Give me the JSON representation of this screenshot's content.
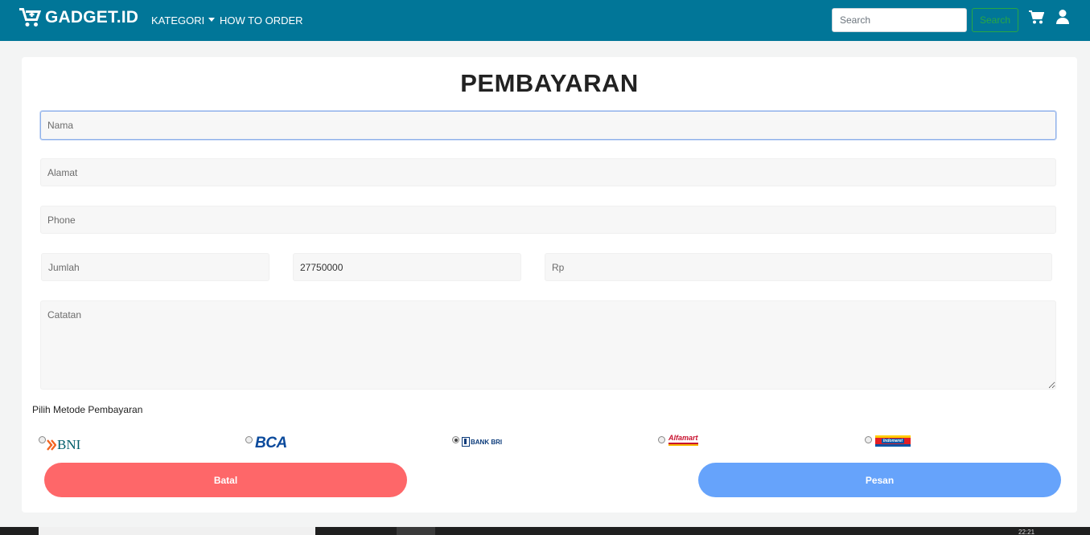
{
  "navbar": {
    "brand": "GADGET.ID",
    "links": [
      {
        "label": "KATEGORI",
        "dropdown": true
      },
      {
        "label": "HOW TO ORDER",
        "dropdown": false
      }
    ],
    "search": {
      "placeholder": "Search",
      "value": "",
      "button_label": "Search"
    },
    "icons": [
      "cart-icon",
      "user-icon"
    ],
    "colors": {
      "background": "#017698",
      "search_button": "#28a745"
    }
  },
  "form": {
    "title": "PEMBAYARAN",
    "fields": {
      "nama": {
        "placeholder": "Nama",
        "value": ""
      },
      "alamat": {
        "placeholder": "Alamat",
        "value": ""
      },
      "phone": {
        "placeholder": "Phone",
        "value": ""
      },
      "jumlah": {
        "placeholder": "Jumlah",
        "value": ""
      },
      "harga": {
        "placeholder": "",
        "value": "27750000"
      },
      "rp": {
        "placeholder": "Rp",
        "value": ""
      },
      "catatan": {
        "placeholder": "Catatan",
        "value": ""
      }
    },
    "payment_label": "Pilih Metode Pembayaran",
    "payment_methods": [
      {
        "name": "BNI",
        "logo_text": "BNI",
        "selected": false
      },
      {
        "name": "BCA",
        "logo_text": "BCA",
        "selected": false
      },
      {
        "name": "BANK BRI",
        "logo_text": "BANK BRI",
        "selected": true
      },
      {
        "name": "Alfamart",
        "logo_text": "Alfamart",
        "selected": false
      },
      {
        "name": "Indomaret",
        "logo_text": "Indomaret",
        "selected": false
      }
    ],
    "buttons": {
      "cancel_label": "Batal",
      "submit_label": "Pesan"
    },
    "colors": {
      "cancel": "#fe6769",
      "submit": "#66a3fb"
    }
  },
  "taskbar": {
    "clock": "22:21"
  }
}
